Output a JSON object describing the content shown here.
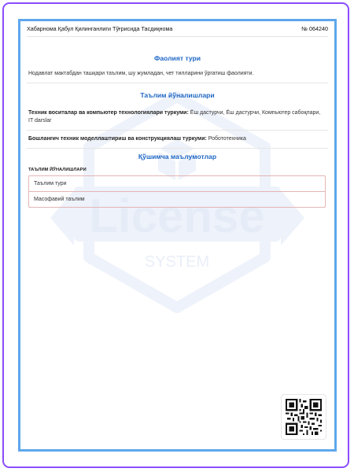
{
  "header": {
    "title": "Хабарнома Қабул Қилинганлиги Тўғрисида Тасдиқнома",
    "number": "№ 064240"
  },
  "activity": {
    "title": "Фаолият тури",
    "text": "Нодавлат мактабдан ташқари таълим, шу жумладан, чет тилларини ўргатиш фаолияти."
  },
  "directions": {
    "title": "Таълим йўналишлари",
    "items": [
      {
        "bold": "Техник воситалар ва компьютер технологиялари туркуми:",
        "text": " Ёш дастурчи, Ёш дастурчи, Компьютер сабоқлари, IT darslar"
      },
      {
        "bold": "Бошланғич техник моделлаштириш ва конструкциялаш туркуми:",
        "text": " Робототехника"
      }
    ]
  },
  "additional": {
    "title": "Қўшимча маълумотлар",
    "caption": "ТАЪЛИМ ЙЎНАЛИШЛАРИ",
    "rows": [
      "Таълим тури",
      "Масофавий таълим"
    ]
  },
  "watermark": {
    "main": "License",
    "sub": "SYSTEM"
  },
  "colors": {
    "frame": "#8a4dff",
    "border": "#5ea7ec",
    "heading": "#1f67c4",
    "table_border": "#e4b5b5"
  },
  "icons": {
    "qr": "qr-code-icon"
  }
}
